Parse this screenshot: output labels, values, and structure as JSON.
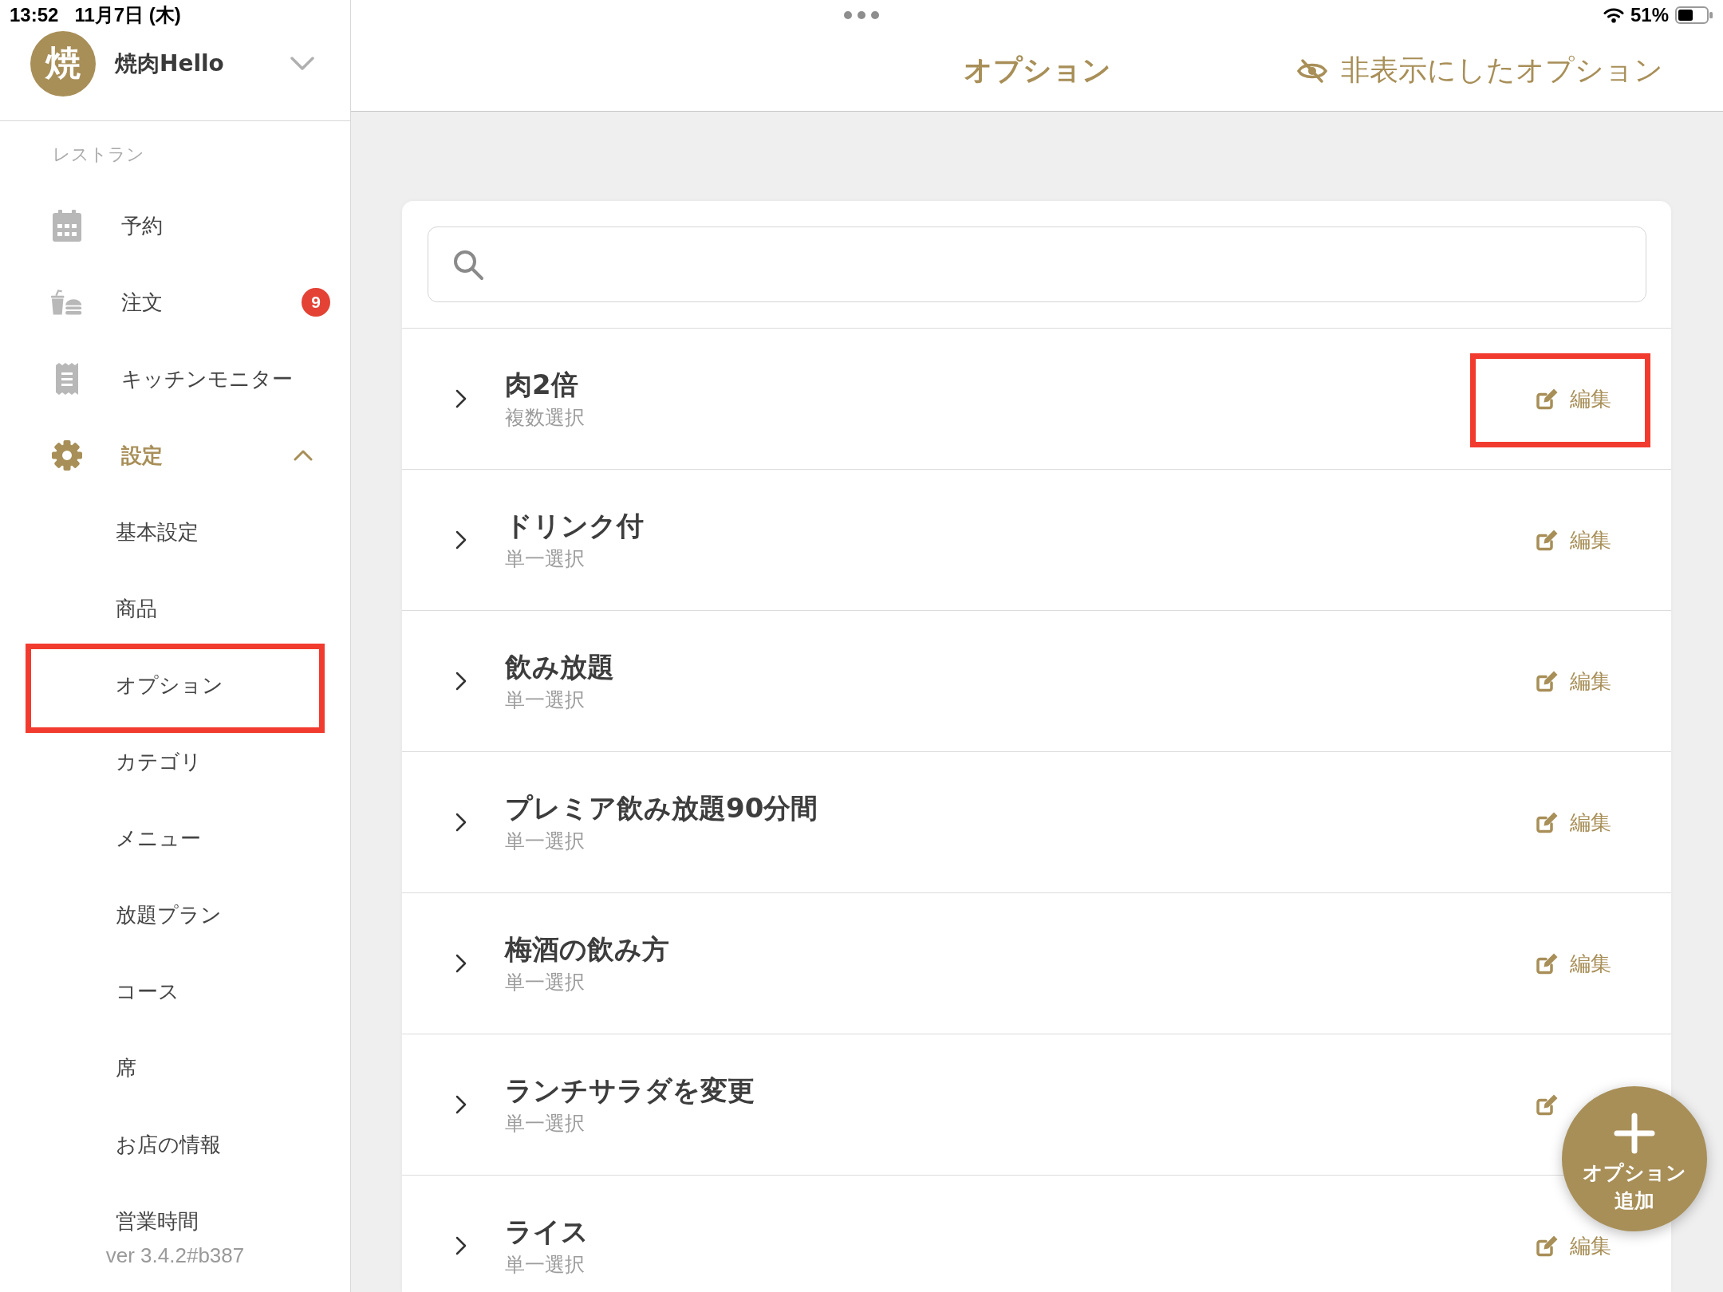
{
  "status_bar": {
    "time": "13:52",
    "date": "11月7日 (木)",
    "battery": "51%"
  },
  "account": {
    "avatar": "焼",
    "name": "焼肉Hello"
  },
  "sidebar": {
    "section": "レストラン",
    "items": [
      {
        "label": "予約",
        "selected": false
      },
      {
        "label": "注文",
        "selected": false,
        "badge": "9"
      },
      {
        "label": "キッチンモニター",
        "selected": false
      },
      {
        "label": "設定",
        "selected": true,
        "expanded": true,
        "children": [
          {
            "label": "基本設定",
            "selected": false,
            "highlighted": false
          },
          {
            "label": "商品",
            "selected": false,
            "highlighted": false
          },
          {
            "label": "オプション",
            "selected": false,
            "highlighted": true
          },
          {
            "label": "カテゴリ",
            "selected": false,
            "highlighted": false
          },
          {
            "label": "メニュー",
            "selected": false,
            "highlighted": false
          },
          {
            "label": "放題プラン",
            "selected": false,
            "highlighted": false
          },
          {
            "label": "コース",
            "selected": false,
            "highlighted": false
          },
          {
            "label": "席",
            "selected": false,
            "highlighted": false
          },
          {
            "label": "お店の情報",
            "selected": false,
            "highlighted": false
          },
          {
            "label": "営業時間",
            "selected": false,
            "highlighted": false
          }
        ]
      }
    ],
    "version": "ver 3.4.2#b387"
  },
  "top_bar": {
    "title": "オプション",
    "hidden_link": "非表示にしたオプション"
  },
  "options": [
    {
      "name": "肉2倍",
      "selection": "複数選択",
      "edit": "編集",
      "highlighted": true
    },
    {
      "name": "ドリンク付",
      "selection": "単一選択",
      "edit": "編集",
      "highlighted": false
    },
    {
      "name": "飲み放題",
      "selection": "単一選択",
      "edit": "編集",
      "highlighted": false
    },
    {
      "name": "プレミア飲み放題90分間",
      "selection": "単一選択",
      "edit": "編集",
      "highlighted": false
    },
    {
      "name": "梅酒の飲み方",
      "selection": "単一選択",
      "edit": "編集",
      "highlighted": false
    },
    {
      "name": "ランチサラダを変更",
      "selection": "単一選択",
      "highlighted": false
    },
    {
      "name": "ライス",
      "selection": "単一選択",
      "edit": "編集",
      "highlighted": false
    }
  ],
  "add_button": {
    "label": "オプション追加"
  }
}
